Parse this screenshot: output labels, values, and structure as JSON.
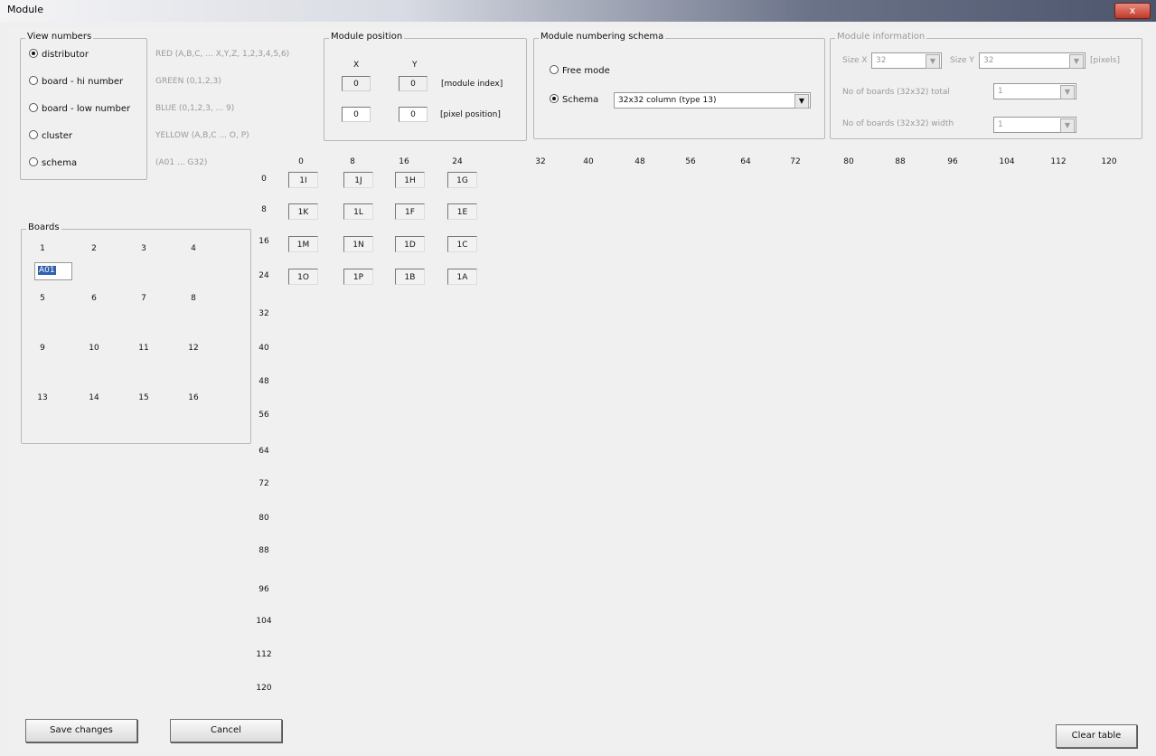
{
  "window": {
    "title": "Module",
    "close_label": "x"
  },
  "view_numbers": {
    "title": "View numbers",
    "options": [
      {
        "label": "distributor",
        "hint": "RED (A,B,C, ... X,Y,Z, 1,2,3,4,5,6)"
      },
      {
        "label": "board - hi number",
        "hint": "GREEN (0,1,2,3)"
      },
      {
        "label": "board - low number",
        "hint": "BLUE (0,1,2,3, ... 9)"
      },
      {
        "label": "cluster",
        "hint": "YELLOW (A,B,C ... O, P)"
      },
      {
        "label": "schema",
        "hint": "(A01 ... G32)"
      }
    ],
    "selected": "distributor"
  },
  "module_position": {
    "title": "Module position",
    "x_label": "X",
    "y_label": "Y",
    "module_index": {
      "x": "0",
      "y": "0",
      "label": "[module index]"
    },
    "pixel_position": {
      "x": "0",
      "y": "0",
      "label": "[pixel position]"
    }
  },
  "numbering_schema": {
    "title": "Module numbering schema",
    "free_mode_label": "Free mode",
    "schema_label": "Schema",
    "selected": "Schema",
    "schema_value": "32x32 column (type 13)"
  },
  "module_info": {
    "title": "Module information",
    "size_x_label": "Size X",
    "size_x": "32",
    "size_y_label": "Size Y",
    "size_y": "32",
    "units": "[pixels]",
    "boards_total_label": "No of boards (32x32) total",
    "boards_total": "1",
    "boards_width_label": "No of boards (32x32) width",
    "boards_width": "1"
  },
  "boards": {
    "title": "Boards",
    "numbers": [
      "1",
      "2",
      "3",
      "4",
      "5",
      "6",
      "7",
      "8",
      "9",
      "10",
      "11",
      "12",
      "13",
      "14",
      "15",
      "16"
    ],
    "selected_value": "A01"
  },
  "grid": {
    "col_headers": [
      "0",
      "8",
      "16",
      "24",
      "32",
      "40",
      "48",
      "56",
      "64",
      "72",
      "80",
      "88",
      "96",
      "104",
      "112",
      "120"
    ],
    "row_headers": [
      "0",
      "8",
      "16",
      "24",
      "32",
      "40",
      "48",
      "56",
      "64",
      "72",
      "80",
      "88",
      "96",
      "104",
      "112",
      "120"
    ],
    "cells": [
      [
        "1I",
        "1J",
        "1H",
        "1G"
      ],
      [
        "1K",
        "1L",
        "1F",
        "1E"
      ],
      [
        "1M",
        "1N",
        "1D",
        "1C"
      ],
      [
        "1O",
        "1P",
        "1B",
        "1A"
      ]
    ]
  },
  "buttons": {
    "save": "Save changes",
    "cancel": "Cancel",
    "clear": "Clear table"
  }
}
